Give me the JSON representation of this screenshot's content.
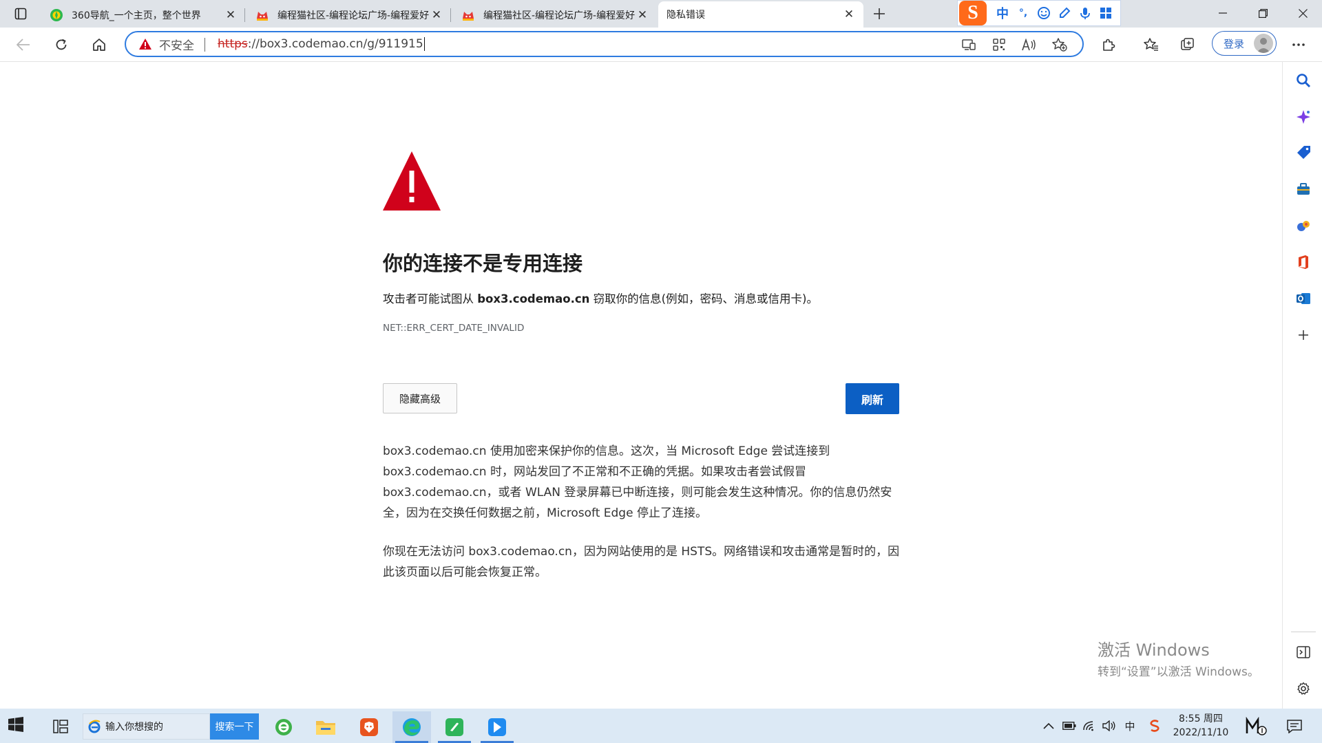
{
  "tabs": [
    {
      "title": "360导航_一个主页，整个世界",
      "favicon": "360-nav-icon"
    },
    {
      "title": "编程猫社区-编程论坛广场-编程爱好者",
      "favicon": "codemao-icon"
    },
    {
      "title": "编程猫社区-编程论坛广场-编程爱好者",
      "favicon": "codemao-icon"
    },
    {
      "title": "隐私错误",
      "favicon": "",
      "active": true
    }
  ],
  "ime": {
    "logo": "S",
    "mode": "中",
    "punct": "°,"
  },
  "address_bar": {
    "security_label": "不安全",
    "url_scheme": "https",
    "url_rest": "://box3.codemao.cn/g/911915"
  },
  "profile": {
    "login_label": "登录"
  },
  "error_page": {
    "heading": "你的连接不是专用连接",
    "desc_prefix": "攻击者可能试图从 ",
    "desc_host": "box3.codemao.cn",
    "desc_suffix": " 窃取你的信息(例如，密码、消息或信用卡)。",
    "error_code": "NET::ERR_CERT_DATE_INVALID",
    "advanced_label": "隐藏高级",
    "refresh_label": "刷新",
    "paragraph_1": "box3.codemao.cn 使用加密来保护你的信息。这次，当 Microsoft Edge 尝试连接到 box3.codemao.cn 时，网站发回了不正常和不正确的凭据。如果攻击者尝试假冒 box3.codemao.cn，或者 WLAN 登录屏幕已中断连接，则可能会发生这种情况。你的信息仍然安全，因为在交换任何数据之前，Microsoft Edge 停止了连接。",
    "paragraph_2": "你现在无法访问 box3.codemao.cn，因为网站使用的是 HSTS。网络错误和攻击通常是暂时的，因此该页面以后可能会恢复正常。"
  },
  "watermark": {
    "line1": "激活 Windows",
    "line2": "转到“设置”以激活 Windows。"
  },
  "taskbar": {
    "search_placeholder": "输入你想搜的",
    "search_button": "搜索一下",
    "clock_time": "8:55 周四",
    "clock_date": "2022/11/10",
    "ime_indicator": "中"
  },
  "colors": {
    "accent": "#0c5fc4",
    "warning": "#d0021b",
    "taskbar": "#dce9f5"
  }
}
